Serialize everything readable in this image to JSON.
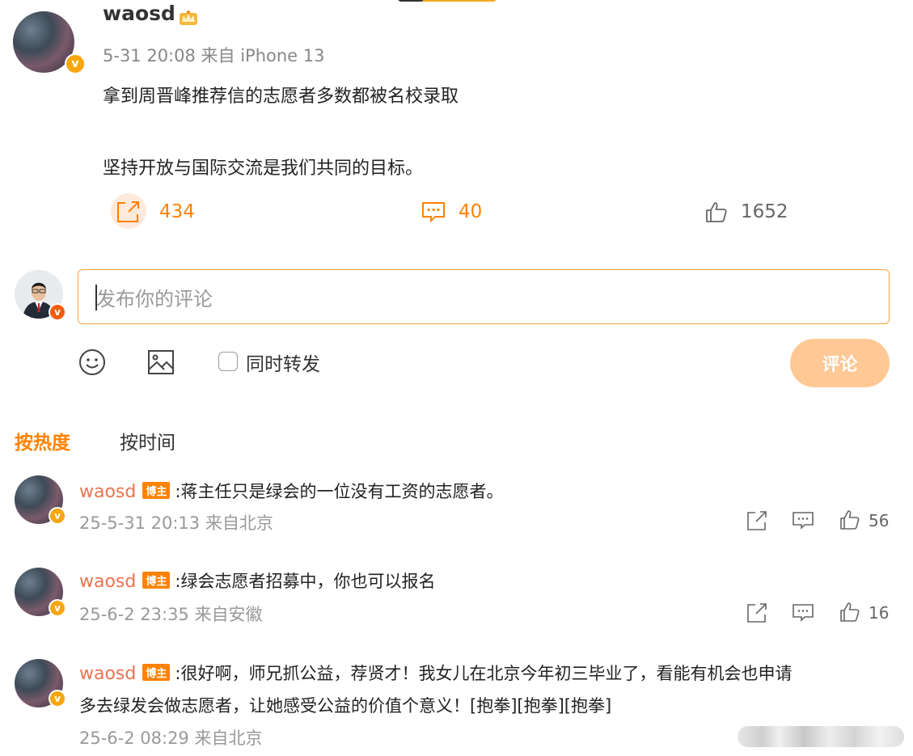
{
  "post": {
    "author": "waosd",
    "time": "5-31 20:08",
    "source": "来自 iPhone 13",
    "lines": [
      "拿到周晋峰推荐信的志愿者多数都被名校录取",
      "坚持开放与国际交流是我们共同的目标。"
    ],
    "reposts": "434",
    "comments": "40",
    "likes": "1652"
  },
  "composer": {
    "placeholder": "发布你的评论",
    "repost_label": "同时转发",
    "submit_label": "评论"
  },
  "sort_tabs": [
    "按热度",
    "按时间"
  ],
  "comments": [
    {
      "author": "waosd",
      "tag": "博主",
      "text": ":蒋主任只是绿会的一位没有工资的志愿者。",
      "meta": "25-5-31 20:13 来自北京",
      "likes": "56"
    },
    {
      "author": "waosd",
      "tag": "博主",
      "text": ":绿会志愿者招募中，你也可以报名",
      "meta": "25-6-2 23:35 来自安徽",
      "likes": "16"
    },
    {
      "author": "waosd",
      "tag": "博主",
      "text": ":很好啊，师兄抓公益，荐贤才！我女儿在北京今年初三毕业了，看能有机会也申请",
      "text2": "多去绿发会做志愿者，让她感受公益的价值个意义！[抱拳][抱拳][抱拳]",
      "meta": "25-6-2 08:29 来自北京"
    }
  ],
  "colors": {
    "accent": "#ff8200",
    "name": "#eb7350",
    "badge": "#f8a60f"
  }
}
